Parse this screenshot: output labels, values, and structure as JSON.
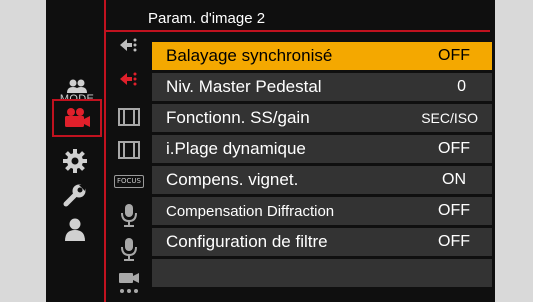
{
  "menu": {
    "title": "Param. d'image 2",
    "mode_label": "MODE",
    "focus_label": "FOCUS",
    "items": [
      {
        "label": "Balayage synchronisé",
        "value": "OFF",
        "selected": true
      },
      {
        "label": "Niv. Master Pedestal",
        "value": "0"
      },
      {
        "label": "Fonctionn. SS/gain",
        "value": "SEC/ISO"
      },
      {
        "label": "i.Plage dynamique",
        "value": "OFF"
      },
      {
        "label": "Compens. vignet.",
        "value": "ON"
      },
      {
        "label": "Compensation Diffraction",
        "value": "OFF"
      },
      {
        "label": "Configuration de filtre",
        "value": "OFF"
      }
    ]
  },
  "colors": {
    "accent_red": "#c1121f",
    "highlight_orange": "#f4a800",
    "row_gray": "#333333",
    "background": "#0f0f0f"
  }
}
